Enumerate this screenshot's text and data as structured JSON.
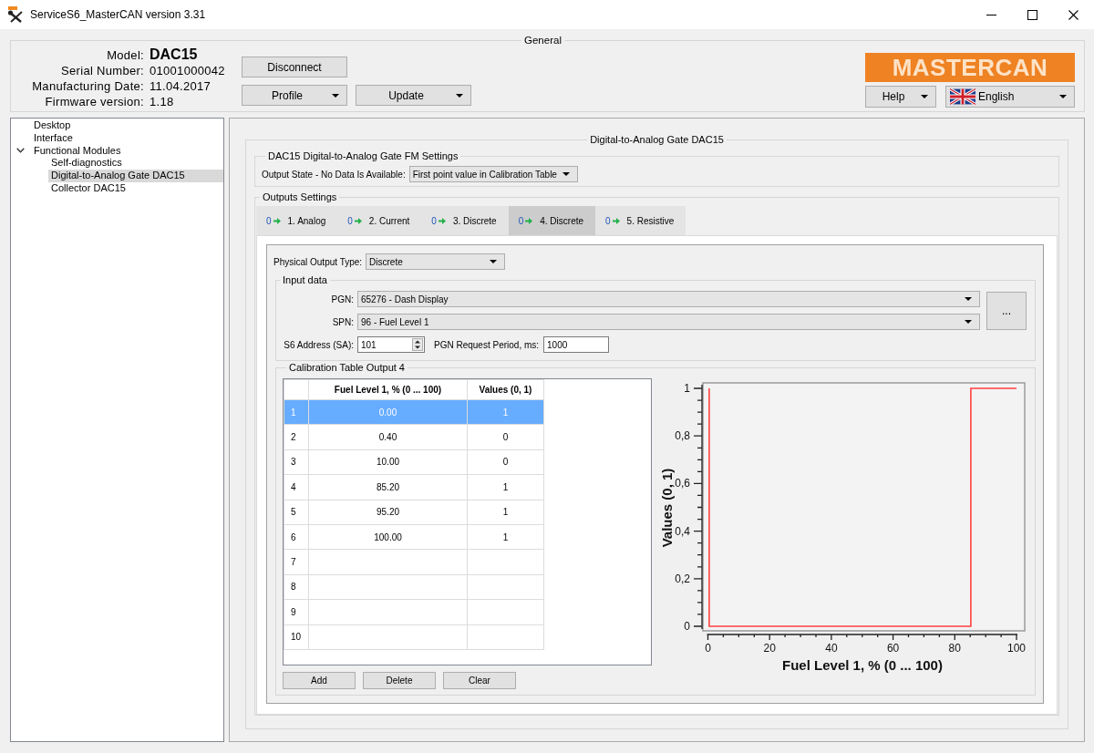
{
  "window": {
    "title": "ServiceS6_MasterCAN version 3.31"
  },
  "general": {
    "title": "General",
    "info": [
      {
        "label": "Model:",
        "value": "DAC15",
        "kind": "headline"
      },
      {
        "label": "Serial Number:",
        "value": "01001000042",
        "kind": "plain"
      },
      {
        "label": "Manufacturing Date:",
        "value": "11.04.2017",
        "kind": "plain"
      },
      {
        "label": "Firmware version:",
        "value": "1.18",
        "kind": "plain"
      }
    ],
    "buttons": [
      {
        "label": "Disconnect",
        "kind": "plain"
      },
      {
        "label": "Profile",
        "kind": "dropdown"
      },
      {
        "label": "Update",
        "kind": "dropdown"
      }
    ],
    "logo": "MASTERCAN",
    "help_button": {
      "label": "Help",
      "kind": "dropdown"
    },
    "language": {
      "label": "English"
    }
  },
  "tree": [
    {
      "label": "Desktop",
      "selected": false
    },
    {
      "label": "Interface",
      "selected": false
    },
    {
      "label": "Functional Modules",
      "selected": false,
      "expanded": true,
      "children": [
        {
          "label": "Self-diagnostics",
          "selected": false
        },
        {
          "label": "Digital-to-Analog Gate DAC15",
          "selected": true
        },
        {
          "label": "Collector DAC15",
          "selected": false
        }
      ]
    }
  ],
  "panel": {
    "title": "Digital-to-Analog Gate DAC15",
    "fm_settings": {
      "title": "DAC15 Digital-to-Analog Gate FM Settings",
      "output_state": {
        "label": "Output State - No Data Is Available:",
        "value": "First point value in Calibration Table"
      }
    },
    "outputs": {
      "title": "Outputs Settings",
      "tabs": [
        {
          "indicator": "0",
          "label": "1. Analog",
          "selected": false
        },
        {
          "indicator": "0",
          "label": "2. Current",
          "selected": false
        },
        {
          "indicator": "0",
          "label": "3. Discrete",
          "selected": false
        },
        {
          "indicator": "0",
          "label": "4. Discrete",
          "selected": true
        },
        {
          "indicator": "0",
          "label": "5. Resistive",
          "selected": false
        }
      ],
      "page": {
        "physical_output_type": {
          "label": "Physical Output Type:",
          "value": "Discrete"
        },
        "input_data": {
          "title": "Input data",
          "pgn": {
            "label": "PGN:",
            "value": "65276 - Dash Display"
          },
          "spn": {
            "label": "SPN:",
            "value": "96 - Fuel Level 1"
          },
          "browse_button": "...",
          "address": {
            "label": "S6 Address (SA):",
            "value": "101"
          },
          "request_period": {
            "label": "PGN Request Period, ms:",
            "value": "1000"
          }
        },
        "calibration": {
          "title": "Calibration Table Output 4",
          "columns": [
            "Fuel Level 1, % (0 ... 100)",
            "Values (0, 1)"
          ],
          "rows": [
            {
              "number": "1",
              "fuel_level": "0.00",
              "value": "1",
              "selected": true
            },
            {
              "number": "2",
              "fuel_level": "0.40",
              "value": "0",
              "selected": false
            },
            {
              "number": "3",
              "fuel_level": "10.00",
              "value": "0",
              "selected": false
            },
            {
              "number": "4",
              "fuel_level": "85.20",
              "value": "1",
              "selected": false
            },
            {
              "number": "5",
              "fuel_level": "95.20",
              "value": "1",
              "selected": false
            },
            {
              "number": "6",
              "fuel_level": "100.00",
              "value": "1",
              "selected": false
            },
            {
              "number": "7",
              "selected": false
            },
            {
              "number": "8",
              "selected": false
            },
            {
              "number": "9",
              "selected": false
            },
            {
              "number": "10",
              "selected": false
            }
          ],
          "buttons": [
            "Add",
            "Delete",
            "Clear"
          ],
          "chart_data": {
            "type": "line",
            "xlabel": "Fuel Level 1, % (0 ... 100)",
            "ylabel": "Values (0, 1)",
            "x": [
              0.4,
              0.4,
              85.2,
              85.2,
              100
            ],
            "series": [
              {
                "color": "#ff4040",
                "values": [
                  1,
                  0,
                  0,
                  1,
                  1
                ]
              }
            ],
            "xlim": [
              0,
              100
            ],
            "ylim": [
              0,
              1
            ],
            "xticks": [
              0,
              20,
              40,
              60,
              80,
              100
            ],
            "yticks": [
              {
                "value": 0,
                "label": "0"
              },
              {
                "value": 0.2,
                "label": "0,2"
              },
              {
                "value": 0.4,
                "label": "0,4"
              },
              {
                "value": 0.6,
                "label": "0,6"
              },
              {
                "value": 0.8,
                "label": "0,8"
              },
              {
                "value": 1,
                "label": "1"
              }
            ]
          }
        }
      }
    }
  }
}
